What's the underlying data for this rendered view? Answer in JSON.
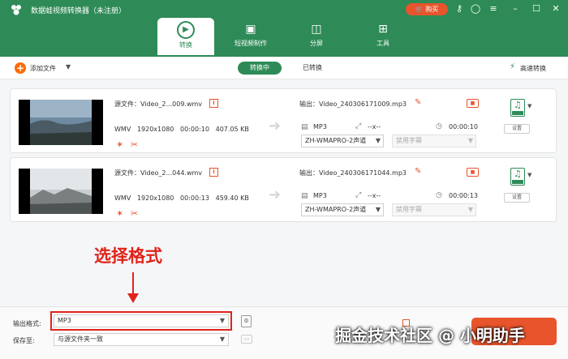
{
  "app": {
    "title": "数据蛙视频转换器（未注册）",
    "buy_label": "购买"
  },
  "tabs": [
    {
      "label": "转换",
      "icon": "convert-icon"
    },
    {
      "label": "短视频制作",
      "icon": "video-maker-icon"
    },
    {
      "label": "分屏",
      "icon": "split-screen-icon"
    },
    {
      "label": "工具",
      "icon": "toolbox-icon"
    }
  ],
  "toolbar": {
    "add_label": "添加文件",
    "seg_converting": "转换中",
    "seg_converted": "已转换",
    "fast_label": "高速转换"
  },
  "files": [
    {
      "source_prefix": "源文件：",
      "source_name": "Video_2...009.wmv",
      "format": "WMV",
      "resolution": "1920x1080",
      "duration": "00:00:10",
      "size": "407.05 KB",
      "output_prefix": "输出：",
      "output_name": "Video_240306171009.mp3",
      "out_format": "MP3",
      "out_resolution": "--x--",
      "out_duration": "00:00:10",
      "audio_track": "ZH-WMAPRO-2声道",
      "subtitle": "禁用字幕",
      "settings_label": "设置"
    },
    {
      "source_prefix": "源文件：",
      "source_name": "Video_2...044.wmv",
      "format": "WMV",
      "resolution": "1920x1080",
      "duration": "00:00:13",
      "size": "459.40 KB",
      "output_prefix": "输出：",
      "output_name": "Video_240306171044.mp3",
      "out_format": "MP3",
      "out_resolution": "--x--",
      "out_duration": "00:00:13",
      "audio_track": "ZH-WMAPRO-2声道",
      "subtitle": "禁用字幕",
      "settings_label": "设置"
    }
  ],
  "annotation": {
    "text": "选择格式"
  },
  "bottom": {
    "output_format_label": "输出格式:",
    "output_format_value": "MP3",
    "save_to_label": "保存至:",
    "save_to_value": "与源文件夹一致"
  },
  "watermark": "掘金技术社区 @ 小明助手",
  "colors": {
    "brand_green": "#2e8b57",
    "accent_orange": "#e8542c",
    "annotation_red": "#e0241a"
  }
}
